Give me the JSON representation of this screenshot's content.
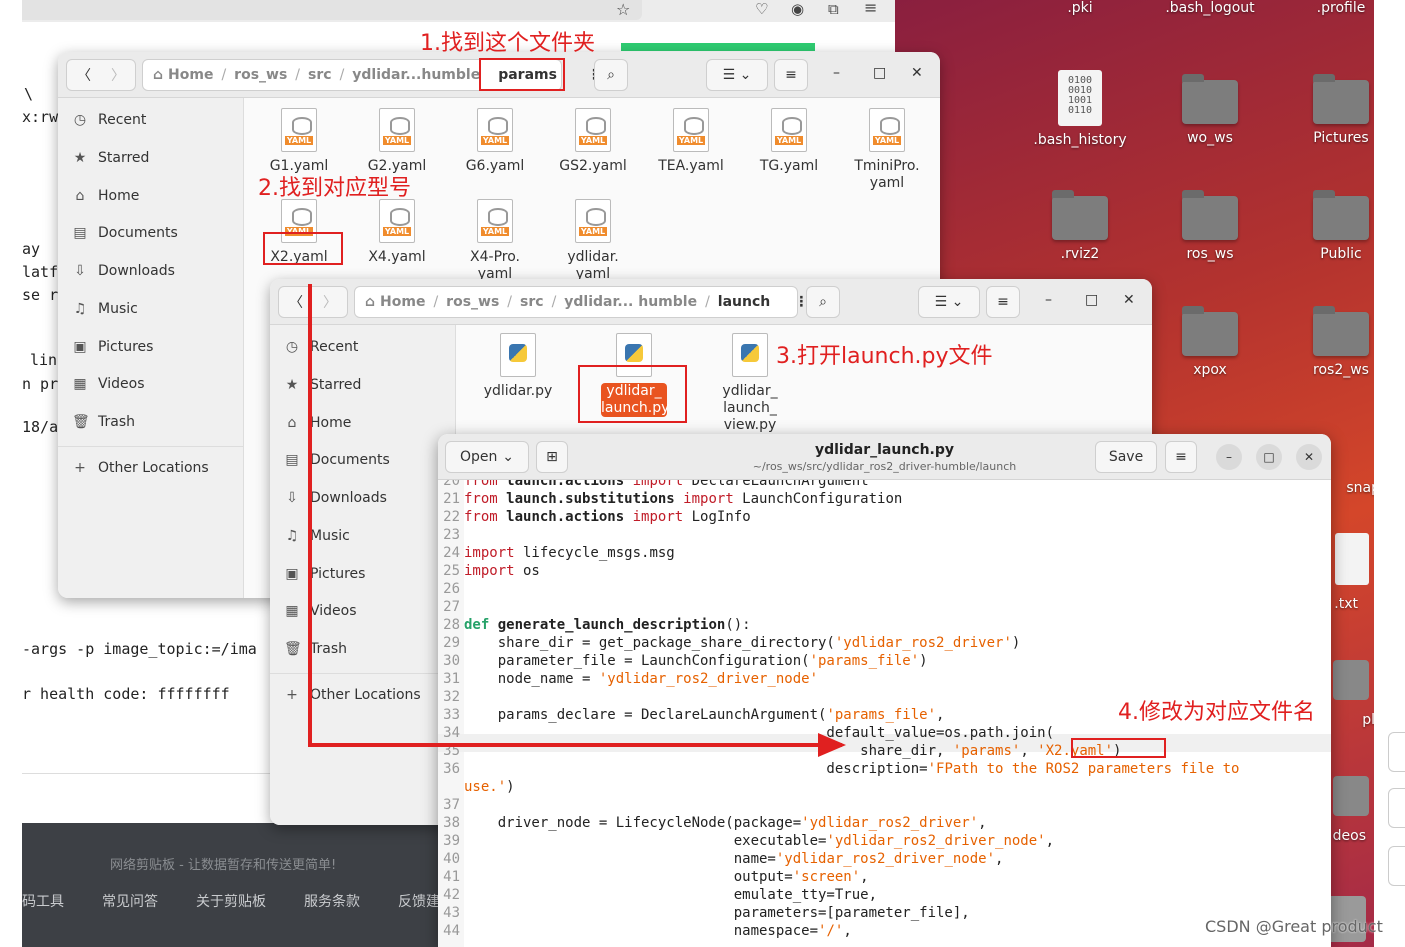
{
  "desktop": {
    "icons": [
      {
        "label": ".pki",
        "kind": "folder"
      },
      {
        "label": ".bash_logout",
        "kind": "file"
      },
      {
        "label": ".profile",
        "kind": "file"
      },
      {
        "label": ".bash_history",
        "kind": "binary",
        "glyph": "0100\n0010\n1001\n0110"
      },
      {
        "label": "wo_ws",
        "kind": "folder"
      },
      {
        "label": "Pictures",
        "kind": "folder"
      },
      {
        "label": ".rviz2",
        "kind": "folder"
      },
      {
        "label": "ros_ws",
        "kind": "folder"
      },
      {
        "label": "Public",
        "kind": "folder"
      },
      {
        "label": "xpox",
        "kind": "folder"
      },
      {
        "label": "ros2_ws",
        "kind": "folder"
      },
      {
        "label": "snap",
        "kind": "folder"
      },
      {
        "label": ".txt",
        "kind": "file"
      },
      {
        "label": "plates",
        "kind": "folder"
      },
      {
        "label": "deos",
        "kind": "folder"
      }
    ],
    "watermark": "CSDN @Great product"
  },
  "background_browser": {
    "terminal_fragments": [
      "\\",
      "x:rw",
      "ay",
      "latf",
      "se r",
      "lin",
      "n pr",
      "18/a"
    ],
    "args_line": "-args -p image_topic:=/ima",
    "health_line": "r health code: ffffffff",
    "footer": {
      "tagline": "网络剪贴板 - 让数据暂存和传送更简单!",
      "links": [
        "码工具",
        "常见问答",
        "关于剪贴板",
        "服务条款",
        "反馈建"
      ]
    }
  },
  "fm1": {
    "path": [
      "Home",
      "ros_ws",
      "src",
      "ydlidar...humble",
      "params"
    ],
    "sidebar": [
      "Recent",
      "Starred",
      "Home",
      "Documents",
      "Downloads",
      "Music",
      "Pictures",
      "Videos",
      "Trash",
      "Other Locations"
    ],
    "files": [
      "G1.yaml",
      "G2.yaml",
      "G6.yaml",
      "GS2.yaml",
      "TEA.yaml",
      "TG.yaml",
      "TminiPro.\nyaml",
      "X2.yaml",
      "X4.yaml",
      "X4-Pro.\nyaml",
      "ydlidar.\nyaml"
    ],
    "yaml_badge": "YAML"
  },
  "fm2": {
    "path": [
      "Home",
      "ros_ws",
      "src",
      "ydlidar... humble",
      "launch"
    ],
    "sidebar": [
      "Recent",
      "Starred",
      "Home",
      "Documents",
      "Downloads",
      "Music",
      "Pictures",
      "Videos",
      "Trash",
      "Other Locations"
    ],
    "files": [
      "ydlidar.py",
      "ydlidar_\nlaunch.py",
      "ydlidar_\nlaunch_\nview.py"
    ]
  },
  "editor": {
    "open_label": "Open",
    "save_label": "Save",
    "title": "ydlidar_launch.py",
    "subtitle": "~/ros_ws/src/ydlidar_ros2_driver-humble/launch"
  },
  "annotations": {
    "step1": "1.找到这个文件夹",
    "step2": "2.找到对应型号",
    "step3": "3.打开launch.py文件",
    "step4": "4.修改为对应文件名"
  },
  "colors": {
    "annotation": "#e02020",
    "selection": "#e95420"
  }
}
